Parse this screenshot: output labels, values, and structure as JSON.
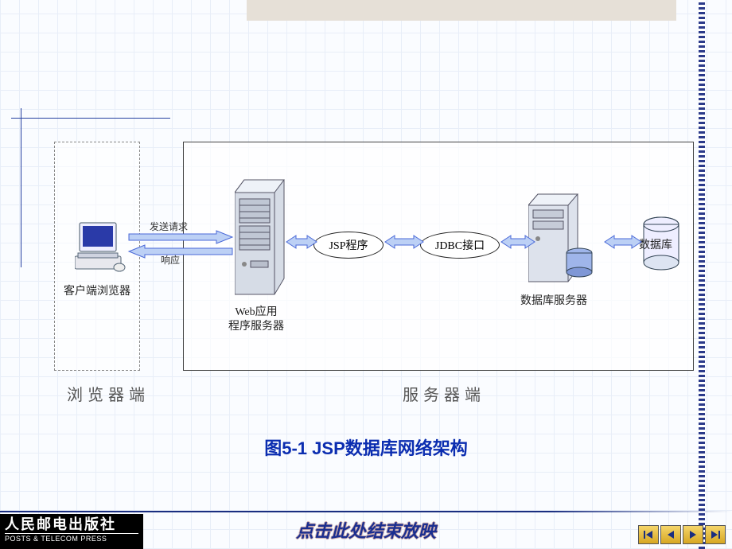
{
  "decor": {
    "top_band": true
  },
  "diagram": {
    "client_box_label": "浏览器端",
    "server_box_label": "服务器端",
    "nodes": {
      "client_pc": "客户端浏览器",
      "web_server": "Web应用\n程序服务器",
      "jsp": "JSP程序",
      "jdbc": "JDBC接口",
      "db_server": "数据库服务器",
      "database": "数据库"
    },
    "edges": {
      "request": "发送请求",
      "response": "响应"
    }
  },
  "caption": "图5-1  JSP数据库网络架构",
  "footer": {
    "publisher_cn": "人民邮电出版社",
    "publisher_en": "POSTS & TELECOM PRESS",
    "end_text": "点击此处结束放映"
  },
  "nav": {
    "first": "first-slide",
    "prev": "previous-slide",
    "next": "next-slide",
    "last": "last-slide"
  }
}
